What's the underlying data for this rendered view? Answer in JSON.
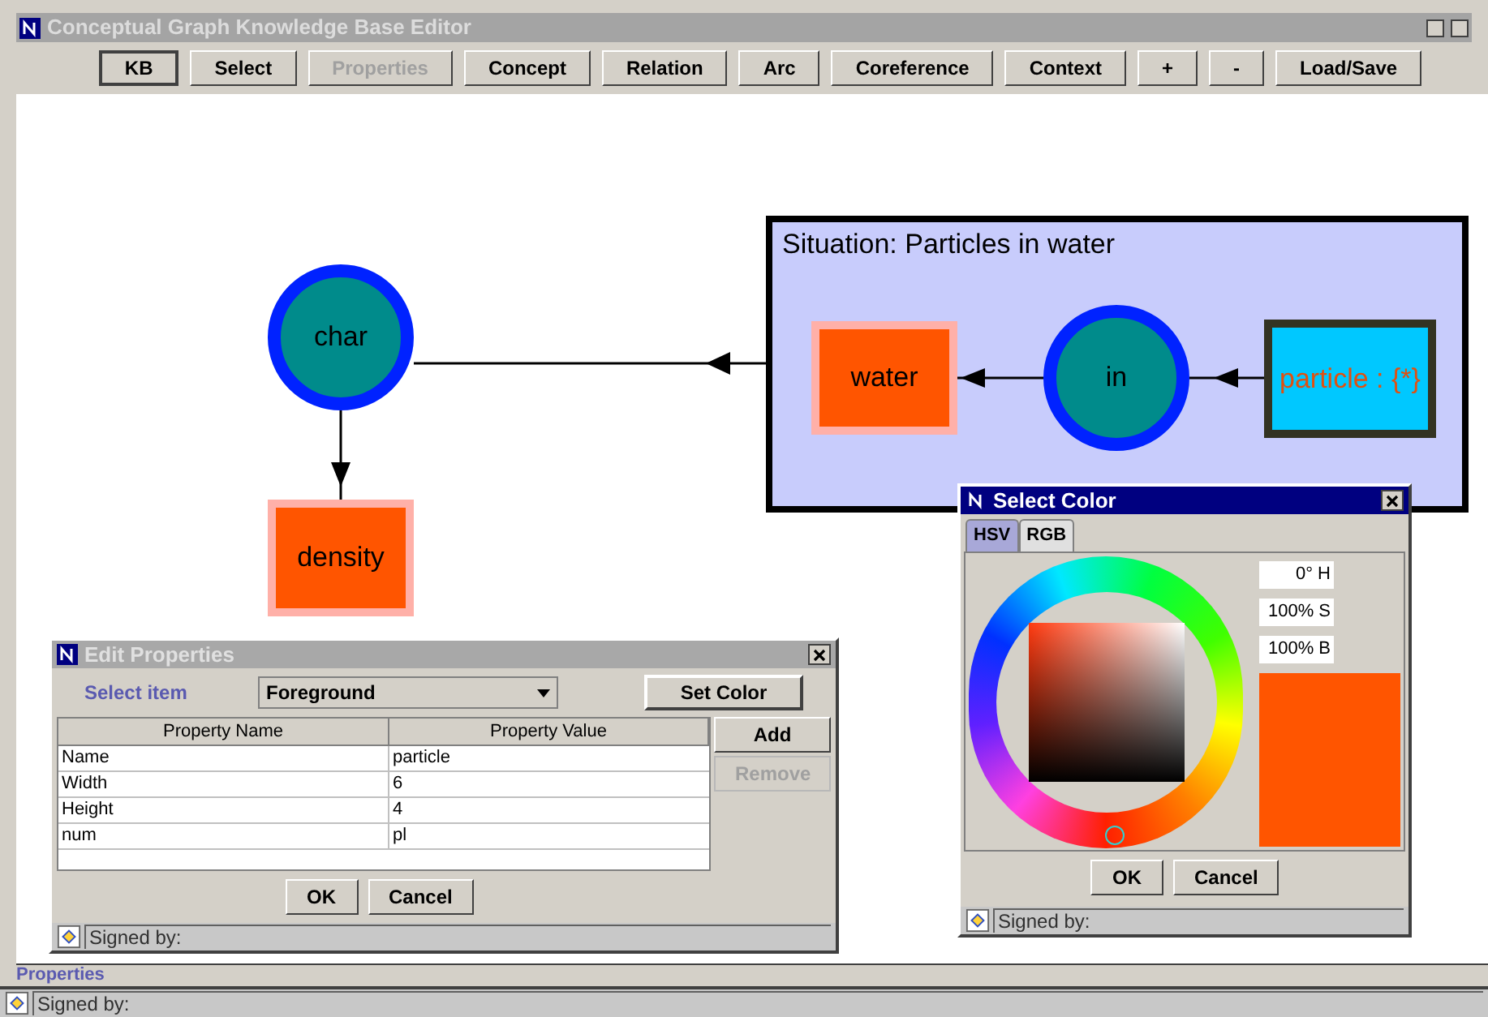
{
  "window": {
    "title": "Conceptual Graph Knowledge Base Editor"
  },
  "toolbar": [
    {
      "label": "KB",
      "selected": true,
      "disabled": false
    },
    {
      "label": "Select",
      "selected": false,
      "disabled": false
    },
    {
      "label": "Properties",
      "selected": false,
      "disabled": true
    },
    {
      "label": "Concept",
      "selected": false,
      "disabled": false
    },
    {
      "label": "Relation",
      "selected": false,
      "disabled": false
    },
    {
      "label": "Arc",
      "selected": false,
      "disabled": false
    },
    {
      "label": "Coreference",
      "selected": false,
      "disabled": false
    },
    {
      "label": "Context",
      "selected": false,
      "disabled": false
    },
    {
      "label": "+",
      "selected": false,
      "disabled": false
    },
    {
      "label": "-",
      "selected": false,
      "disabled": false
    },
    {
      "label": "Load/Save",
      "selected": false,
      "disabled": false
    }
  ],
  "graph": {
    "context": {
      "title": "Situation: Particles in water"
    },
    "nodes": [
      {
        "kind": "relation",
        "label": "char"
      },
      {
        "kind": "concept",
        "label": "density",
        "color": "#ff5500",
        "selected": false
      },
      {
        "kind": "concept",
        "label": "water",
        "color": "#ff5500",
        "selected": false
      },
      {
        "kind": "relation",
        "label": "in"
      },
      {
        "kind": "concept",
        "label": "particle : {*}",
        "color": "#00c8ff",
        "selected": true
      }
    ]
  },
  "edit_dialog": {
    "title": "Edit Properties",
    "select_label": "Select item",
    "select_value": "Foreground",
    "set_color": "Set Color",
    "columns": [
      "Property Name",
      "Property Value"
    ],
    "rows": [
      {
        "name": "Name",
        "value": "particle"
      },
      {
        "name": "Width",
        "value": "6"
      },
      {
        "name": "Height",
        "value": "4"
      },
      {
        "name": "num",
        "value": "pl"
      }
    ],
    "side_buttons": [
      {
        "label": "Add",
        "disabled": false
      },
      {
        "label": "Remove",
        "disabled": true
      }
    ],
    "buttons": [
      "OK",
      "Cancel"
    ],
    "status": "Signed by:"
  },
  "color_dialog": {
    "title": "Select Color",
    "tabs": [
      {
        "label": "HSV",
        "selected": true
      },
      {
        "label": "RGB",
        "selected": false
      }
    ],
    "fields": [
      "0° H",
      "100% S",
      "100% B"
    ],
    "buttons": [
      "OK",
      "Cancel"
    ],
    "status": "Signed by:"
  },
  "footer": {
    "label": "Properties"
  },
  "status_bar": {
    "text": "Signed by:"
  }
}
